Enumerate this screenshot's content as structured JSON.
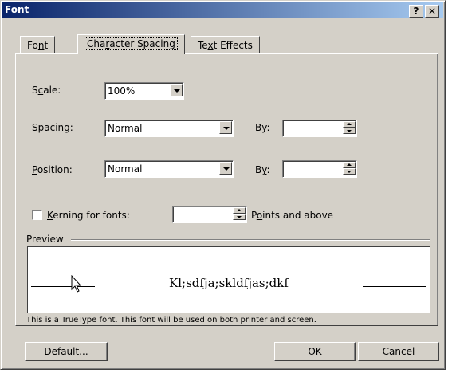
{
  "window": {
    "title": "Font",
    "help_button": "?",
    "close_button": "✕"
  },
  "tabs": [
    {
      "pre": "Fo",
      "key": "n",
      "post": "t"
    },
    {
      "pre": "Cha",
      "key": "r",
      "post": "acter Spacing"
    },
    {
      "pre": "Te",
      "key": "x",
      "post": "t Effects"
    }
  ],
  "fields": {
    "scale": {
      "pre": "S",
      "key": "c",
      "post": "ale:",
      "value": "100%"
    },
    "spacing": {
      "pre": "",
      "key": "S",
      "post": "pacing:",
      "value": "Normal",
      "by": {
        "pre": "",
        "key": "B",
        "post": "y:"
      }
    },
    "position": {
      "pre": "",
      "key": "P",
      "post": "osition:",
      "value": "Normal",
      "by": {
        "pre": "B",
        "key": "y",
        "post": ":"
      }
    },
    "kerning": {
      "pre": "",
      "key": "K",
      "post": "erning for fonts:",
      "suffix_pre": "P",
      "suffix_key": "o",
      "suffix_post": "ints and above"
    }
  },
  "preview": {
    "label": "Preview",
    "sample": "Kl;sdfja;skldfjas;dkf",
    "note": "This is a TrueType font. This font will be used on both printer and screen."
  },
  "buttons": {
    "default": {
      "pre": "",
      "key": "D",
      "post": "efault..."
    },
    "ok": "OK",
    "cancel": "Cancel"
  }
}
